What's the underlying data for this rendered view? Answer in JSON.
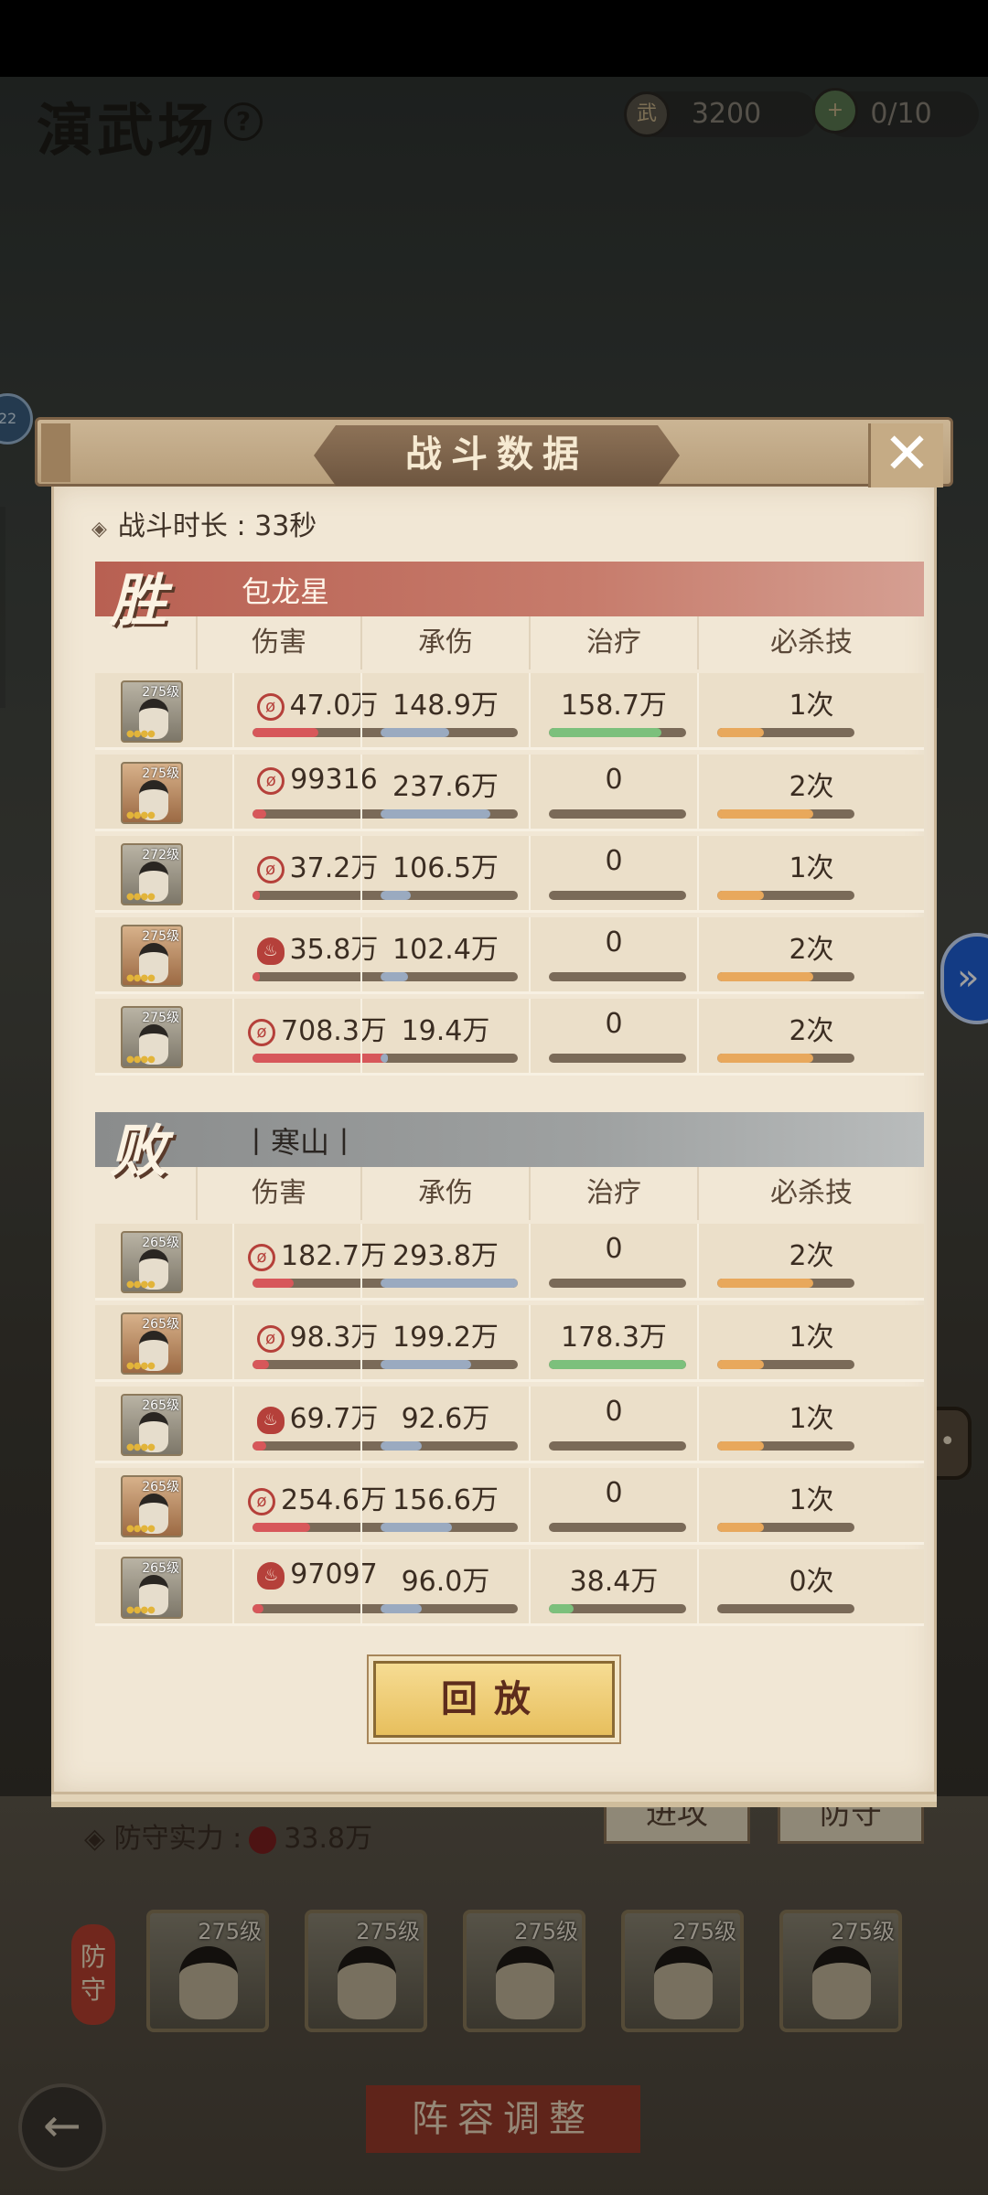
{
  "header": {
    "title": "演武场",
    "help": "?",
    "coins": "3200",
    "coin_icon": "武",
    "tickets": "0/10"
  },
  "side_badge": "22",
  "background": {
    "tab_attack": "进攻",
    "tab_other": "防守",
    "defense_label": "防守实力 :",
    "defense_value": "33.8万",
    "defense_tag": "防守",
    "lineup_button": "阵容调整",
    "back_icon": "arrow-left-icon",
    "heroes": [
      {
        "level": "275级"
      },
      {
        "level": "275级"
      },
      {
        "level": "275级"
      },
      {
        "level": "275级"
      },
      {
        "level": "275级"
      }
    ]
  },
  "dialog": {
    "title": "战斗数据",
    "close": "✕",
    "duration": "战斗时长 : 33秒",
    "columns": [
      "伤害",
      "承伤",
      "治疗",
      "必杀技"
    ],
    "replay": "回放",
    "teams": [
      {
        "result": "胜",
        "name": "包龙星",
        "rows": [
          {
            "level": "275级",
            "dmg_icon": "slash",
            "damage": "47.0万",
            "taken": "148.9万",
            "heal": "158.7万",
            "ult": "1次",
            "f": [
              0.48,
              0.5,
              0.82,
              0.34
            ]
          },
          {
            "level": "275级",
            "dmg_icon": "slash",
            "damage": "99316",
            "taken": "237.6万",
            "heal": "0",
            "ult": "2次",
            "f": [
              0.1,
              0.8,
              0,
              0.7
            ]
          },
          {
            "level": "272级",
            "dmg_icon": "slash",
            "damage": "37.2万",
            "taken": "106.5万",
            "heal": "0",
            "ult": "1次",
            "f": [
              0.05,
              0.22,
              0,
              0.34
            ]
          },
          {
            "level": "275级",
            "dmg_icon": "fire",
            "damage": "35.8万",
            "taken": "102.4万",
            "heal": "0",
            "ult": "2次",
            "f": [
              0.05,
              0.2,
              0,
              0.7
            ]
          },
          {
            "level": "275级",
            "dmg_icon": "slash",
            "damage": "708.3万",
            "taken": "19.4万",
            "heal": "0",
            "ult": "2次",
            "f": [
              1.0,
              0.05,
              0,
              0.7
            ]
          }
        ]
      },
      {
        "result": "败",
        "name": "丨寒山丨",
        "rows": [
          {
            "level": "265级",
            "dmg_icon": "slash",
            "damage": "182.7万",
            "taken": "293.8万",
            "heal": "0",
            "ult": "2次",
            "f": [
              0.3,
              1.0,
              0,
              0.7
            ]
          },
          {
            "level": "265级",
            "dmg_icon": "slash",
            "damage": "98.3万",
            "taken": "199.2万",
            "heal": "178.3万",
            "ult": "1次",
            "f": [
              0.12,
              0.66,
              1.0,
              0.34
            ]
          },
          {
            "level": "265级",
            "dmg_icon": "fire",
            "damage": "69.7万",
            "taken": "92.6万",
            "heal": "0",
            "ult": "1次",
            "f": [
              0.1,
              0.3,
              0,
              0.34
            ]
          },
          {
            "level": "265级",
            "dmg_icon": "slash",
            "damage": "254.6万",
            "taken": "156.6万",
            "heal": "0",
            "ult": "1次",
            "f": [
              0.42,
              0.52,
              0,
              0.34
            ]
          },
          {
            "level": "265级",
            "dmg_icon": "fire",
            "damage": "97097",
            "taken": "96.0万",
            "heal": "38.4万",
            "ult": "0次",
            "f": [
              0.08,
              0.3,
              0.18,
              0
            ]
          }
        ]
      }
    ]
  }
}
